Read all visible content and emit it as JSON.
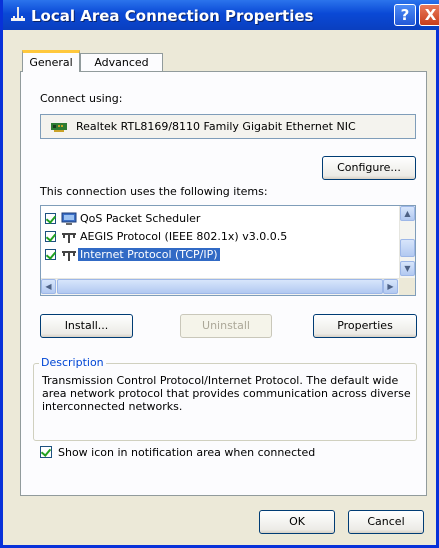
{
  "window": {
    "title": "Local Area Connection Properties",
    "help_glyph": "?",
    "close_glyph": "X"
  },
  "tabs": [
    {
      "label": "General",
      "selected": true
    },
    {
      "label": "Advanced",
      "selected": false
    }
  ],
  "connect_using": {
    "label": "Connect using:",
    "adapter": "Realtek RTL8169/8110 Family Gigabit Ethernet NIC"
  },
  "configure_button": "Configure...",
  "items_label": "This connection uses the following items:",
  "items": [
    {
      "label": "QoS Packet Scheduler",
      "checked": true,
      "icon": "scheduler-icon",
      "selected": false
    },
    {
      "label": "AEGIS Protocol (IEEE 802.1x) v3.0.0.5",
      "checked": true,
      "icon": "protocol-icon",
      "selected": false
    },
    {
      "label": "Internet Protocol (TCP/IP)",
      "checked": true,
      "icon": "protocol-icon",
      "selected": true
    }
  ],
  "buttons": {
    "install": "Install...",
    "uninstall": "Uninstall",
    "properties": "Properties",
    "ok": "OK",
    "cancel": "Cancel"
  },
  "description": {
    "title": "Description",
    "text": "Transmission Control Protocol/Internet Protocol. The default wide area network protocol that provides communication across diverse interconnected networks."
  },
  "notification": {
    "label": "Show icon in notification area when connected",
    "checked": true
  },
  "colors": {
    "titlebar": "#0A49D6",
    "selection": "#316AC5",
    "tab_accent": "#FFC83C"
  }
}
